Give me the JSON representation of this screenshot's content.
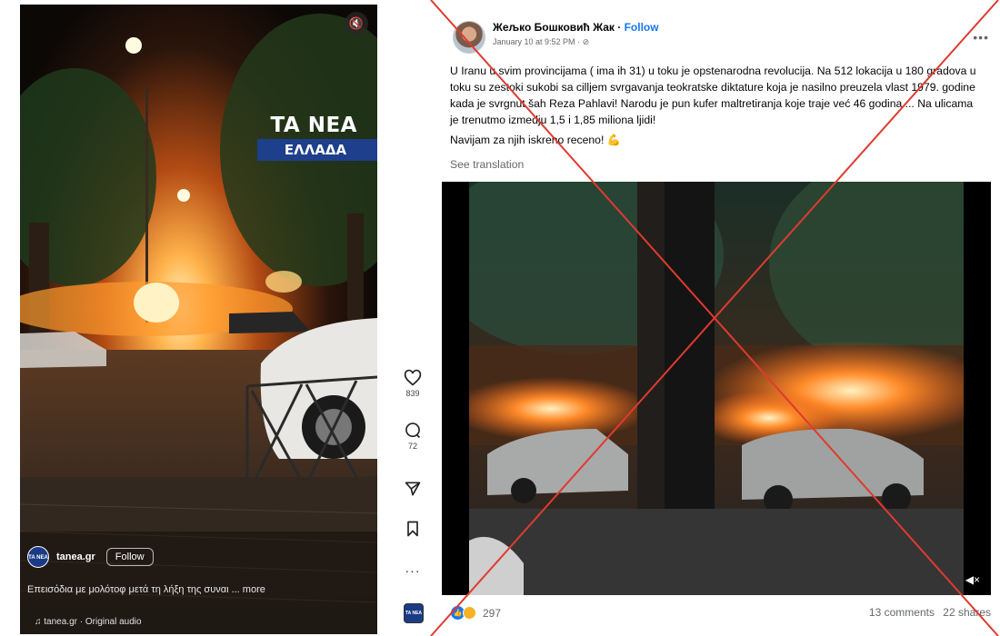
{
  "reel": {
    "brand_title": "TA NEA",
    "brand_subtitle": "ΕΛΛΑΔΑ",
    "mute_icon": "speaker-muted-icon",
    "account": {
      "avatar_text": "TA NEA",
      "username": "tanea.gr",
      "follow_label": "Follow"
    },
    "caption": "Επεισόδια με μολότοφ μετά τη λήξη της συναι ... more",
    "audio": "tanea.gr · Original audio",
    "rail": {
      "likes": "839",
      "comments": "72",
      "avatar_text": "TA NEA"
    }
  },
  "fb_post": {
    "author": "Жељко Бошковић Жак",
    "follow_label": "Follow",
    "date": "January 10 at 9:52 PM ·",
    "text": "U Iranu u svim provincijama ( ima ih 31) u toku je opstenarodna revolucija. Na 512 lokacija u 180 gradova u toku su zestoki sukobi sa cilljem svrgavanja teokratske diktature koja je nasilno preuzela vlast 1979. godine kada je svrgnut šah Reza Pahlavi! Narodu je pun kufer maltretiranja koje traje već 46 godina.... Na ulicama je trenutmo izmedju 1,5 i 1,85 miliona ljidi!",
    "text2": "Navijam za njih iskreno receno! 💪",
    "see_translation": "See translation",
    "reactions_count": "297",
    "comments": "13 comments",
    "shares": "22 shares"
  },
  "overlay": {
    "cross_color": "#e03a2f"
  }
}
